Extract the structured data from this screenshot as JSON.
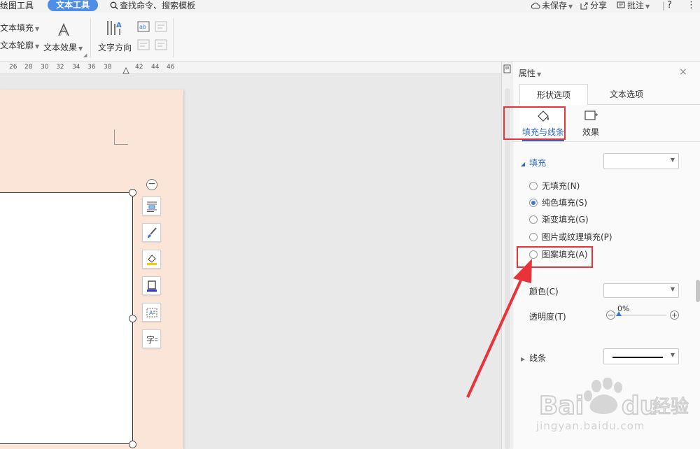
{
  "topbar": {
    "drawing_tools_tab": "绘图工具",
    "text_tools_tab": "文本工具",
    "search_placeholder": "查找命令、搜索模板",
    "unsaved_label": "未保存",
    "share_label": "分享",
    "comment_label": "批注",
    "help_label": "?",
    "more_label": "⋮"
  },
  "ribbon": {
    "text_fill": "文本填充",
    "text_outline": "文本轮廓",
    "text_effect": "文本效果",
    "text_direction": "文字方向"
  },
  "ruler": {
    "ticks": [
      "26",
      "28",
      "30",
      "32",
      "34",
      "36",
      "38",
      "42",
      "44",
      "46"
    ]
  },
  "panel": {
    "title": "属性",
    "close": "×",
    "tab_shape": "形状选项",
    "tab_text": "文本选项",
    "sub_fill_line": "填充与线条",
    "sub_effect": "效果",
    "fill_section": "填充",
    "no_fill": "无填充(N)",
    "solid_fill": "纯色填充(S)",
    "gradient_fill": "渐变填充(G)",
    "picture_fill": "图片或纹理填充(P)",
    "pattern_fill": "图案填充(A)",
    "selected_fill": "solid_fill",
    "color_label": "颜色(C)",
    "transparency_label": "透明度(T)",
    "transparency_value": "0%",
    "transparency_level": 0,
    "line_section": "线条"
  },
  "watermark": {
    "brand": "Baidu 经验",
    "url": "jingyan.baidu.com"
  },
  "colors": {
    "accent": "#4e8ee6",
    "highlight": "#e8333a",
    "page_bg": "#fbe4d8"
  }
}
